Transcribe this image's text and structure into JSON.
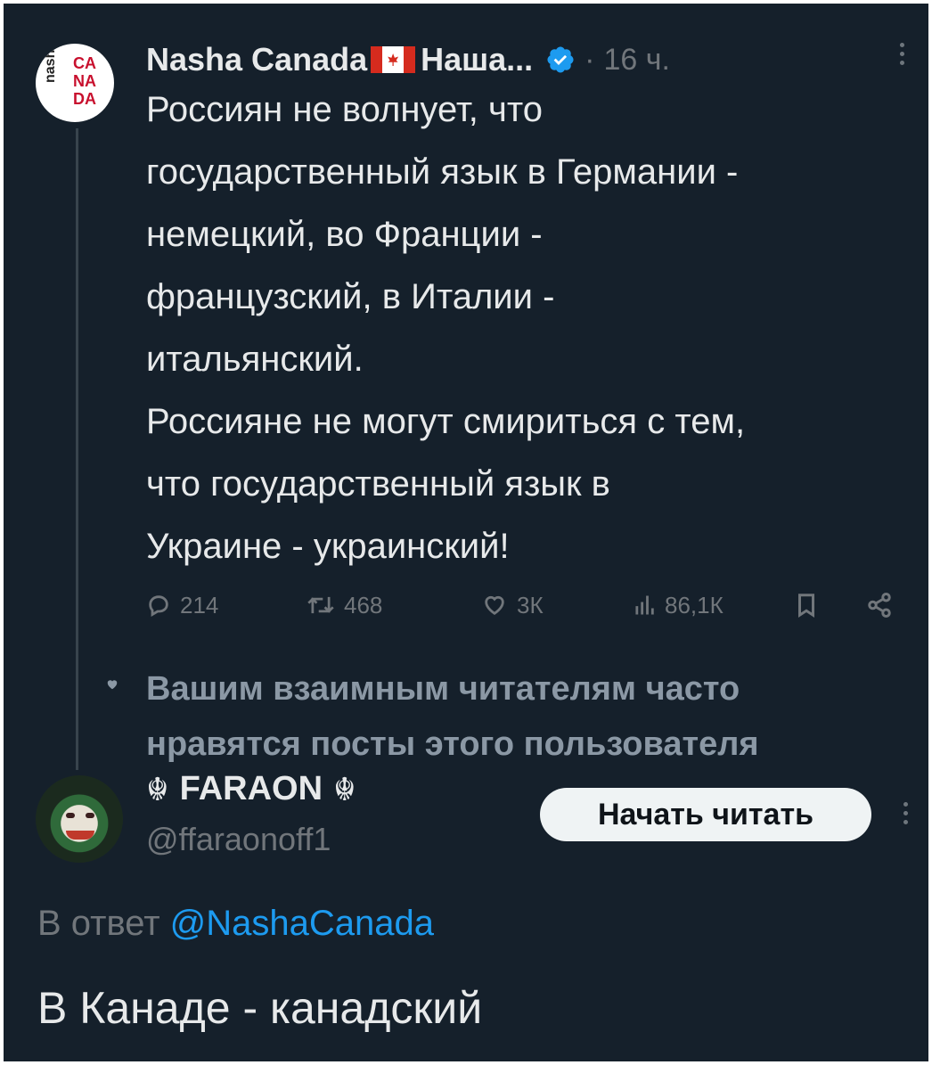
{
  "post": {
    "author_name": "Nasha Canada",
    "author_name_suffix": "Наша...",
    "avatar_letters": [
      "CA",
      "NA",
      "DA"
    ],
    "avatar_side": "nasha",
    "time": "16 ч.",
    "dot_separator": "·",
    "lines": [
      "Россиян не волнует, что",
      "государственный язык в Германии -",
      "немецкий, во Франции -",
      "французский, в Италии -",
      "итальянский.",
      "Россияне не могут смириться с тем,",
      "что государственный язык в",
      "Украине - украинский!"
    ],
    "stats": {
      "replies": "214",
      "reposts": "468",
      "likes": "3К",
      "views": "86,1К"
    }
  },
  "mutuals_notice": {
    "line1": "Вашим взаимным читателям часто",
    "line2": "нравятся посты этого пользователя"
  },
  "user": {
    "symbol": "☬",
    "name": "FARAON",
    "handle": "@ffaraonoff1",
    "follow_label": "Начать читать"
  },
  "reply": {
    "prefix": "В ответ",
    "mention": "@NashaCanada",
    "text": "В Канаде - канадский"
  },
  "colors": {
    "background": "#15202b",
    "text": "#e7e9ea",
    "muted": "#71767b",
    "accent": "#1d9bf0"
  }
}
